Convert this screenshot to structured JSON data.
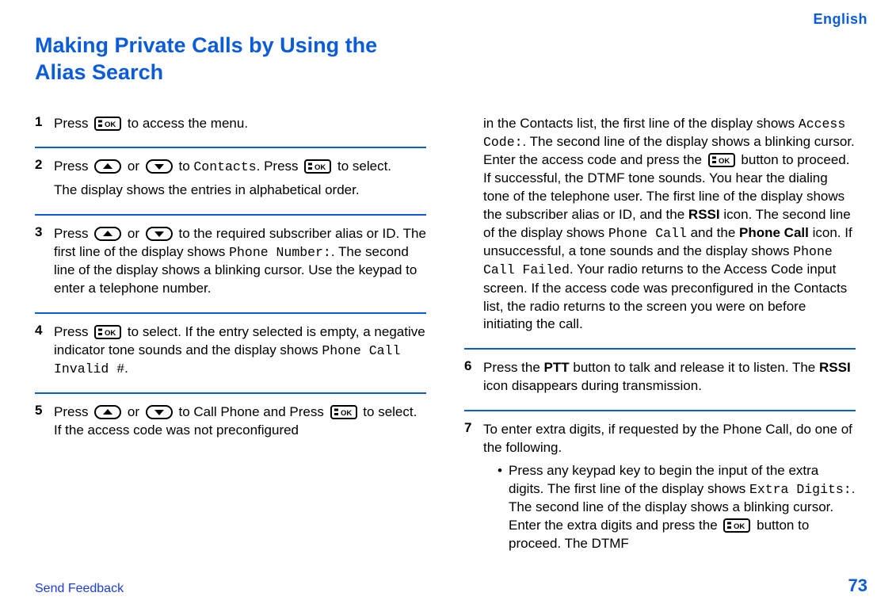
{
  "header": {
    "language": "English"
  },
  "title": "Making Private Calls by Using the Alias Search",
  "icons": {
    "ok": "ok-button-icon",
    "up": "up-nav-icon",
    "down": "down-nav-icon"
  },
  "text": {
    "press": "Press ",
    "or": " or ",
    "to_access_menu": " to access the menu.",
    "to": " to ",
    "contacts": "Contacts",
    "press_ok_to_select": " to select.",
    "dot_press": ". Press ",
    "step2_para2": "The display shows the entries in alphabetical order.",
    "step3_a": " to the required subscriber alias or ID. The first line of the display shows ",
    "phone_number": "Phone Number:",
    "step3_b": ". The second line of the display shows a blinking cursor. Use the keypad to enter a telephone number.",
    "step4_a": " to select. If the entry selected is empty, a negative indicator tone sounds and the display shows ",
    "phone_call_invalid": "Phone Call Invalid #",
    "period": ".",
    "step4_b": "",
    "step5_a": " to Call Phone and Press ",
    "step5_b": " to select. If the access code was not preconfigured",
    "r_step5_a": "in the Contacts list, the first line of the display shows ",
    "access_code": "Access Code:",
    "r_step5_b": ". The second line of the display shows a blinking cursor. Enter the access code and press the ",
    "r_step5_c": " button to proceed. If successful, the DTMF tone sounds. You hear the dialing tone of the telephone user. The first line of the display shows the subscriber alias or ID, and the ",
    "rssi": "RSSI",
    "r_step5_d": " icon. The second line of the display shows ",
    "phone_call": "Phone Call",
    "r_step5_e": " and the ",
    "phone_call_bold": "Phone Call",
    "r_step5_f": " icon. If unsuccessful, a tone sounds and the display shows ",
    "phone_call_failed": "Phone Call Failed",
    "r_step5_g": ". Your radio returns to the Access Code input screen. If the access code was preconfigured in the Contacts list, the radio returns to the screen you were on before initiating the call.",
    "step6_a": "Press the ",
    "ptt": "PTT",
    "step6_b": " button to talk and release it to listen. The ",
    "step6_c": " icon disappears during transmission.",
    "step7_a": "To enter extra digits, if requested by the Phone Call, do one of the following.",
    "step7_bullet_a": "Press any keypad key to begin the input of the extra digits. The first line of the display shows ",
    "extra_digits": "Extra Digits:",
    "step7_bullet_b": ". The second line of the display shows a blinking cursor. Enter the extra digits and press the ",
    "step7_bullet_c": " button to proceed. The DTMF"
  },
  "steps": {
    "s1": "1",
    "s2": "2",
    "s3": "3",
    "s4": "4",
    "s5": "5",
    "s6": "6",
    "s7": "7"
  },
  "footer": {
    "feedback": "Send Feedback",
    "page": "73"
  }
}
